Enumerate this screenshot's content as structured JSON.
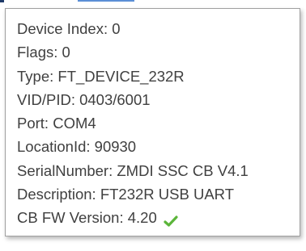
{
  "tooltip": {
    "lines": [
      "Device Index: 0",
      "Flags: 0",
      "Type: FT_DEVICE_232R",
      "VID/PID: 0403/6001",
      "Port: COM4",
      "LocationId: 90930",
      "SerialNumber: ZMDI SSC CB V4.1",
      "Description: FT232R USB UART",
      "CB FW Version: 4.20"
    ],
    "fw_status_icon": "check-icon",
    "fw_status_color": "#5bb53a"
  }
}
